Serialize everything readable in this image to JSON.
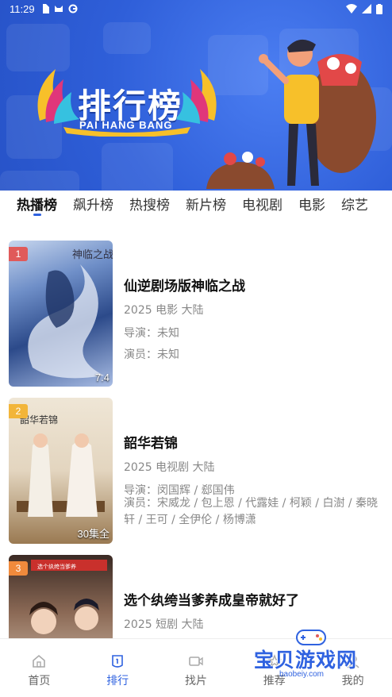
{
  "status_bar": {
    "time": "11:29"
  },
  "banner": {
    "title": "排行榜",
    "subtitle": "PAI HANG BANG",
    "colors": {
      "background": "#2f5fd9",
      "accent": "#f7c02a"
    }
  },
  "tabs": [
    {
      "label": "热播榜",
      "active": true
    },
    {
      "label": "飙升榜",
      "active": false
    },
    {
      "label": "热搜榜",
      "active": false
    },
    {
      "label": "新片榜",
      "active": false
    },
    {
      "label": "电视剧",
      "active": false
    },
    {
      "label": "电影",
      "active": false
    },
    {
      "label": "综艺",
      "active": false
    }
  ],
  "items": [
    {
      "rank": "1",
      "rank_color": "#e05a5a",
      "poster_tag": "7.4",
      "poster_text": "神临之战",
      "title": "仙逆剧场版神临之战",
      "meta": "2025 电影 大陆",
      "director": "导演：未知",
      "cast": "演员：未知"
    },
    {
      "rank": "2",
      "rank_color": "#f2b53a",
      "poster_tag": "30集全",
      "poster_text": "韶华若锦",
      "title": "韶华若锦",
      "meta": "2025 电视剧 大陆",
      "director": "导演：闵国辉 / 郄国伟",
      "cast": "演员：宋威龙 / 包上恩 / 代露娃 / 柯颖 / 白澍 / 秦晓轩 / 王可 / 全伊伦 / 杨博潇"
    },
    {
      "rank": "3",
      "rank_color": "#f08a3c",
      "poster_tag": "",
      "poster_text": "选个纨绔当爹养",
      "title": "选个纨绔当爹养成皇帝就好了",
      "meta": "2025 短剧 大陆",
      "director": "",
      "cast": ""
    }
  ],
  "nav": [
    {
      "label": "首页",
      "icon": "home-icon",
      "active": false
    },
    {
      "label": "排行",
      "icon": "ranking-icon",
      "active": true
    },
    {
      "label": "找片",
      "icon": "video-icon",
      "active": false
    },
    {
      "label": "推荐",
      "icon": "recommend-icon",
      "active": false
    },
    {
      "label": "我的",
      "icon": "profile-icon",
      "active": false
    }
  ],
  "watermark": {
    "text": "宝贝游戏网",
    "url": "baobeiy.com"
  }
}
